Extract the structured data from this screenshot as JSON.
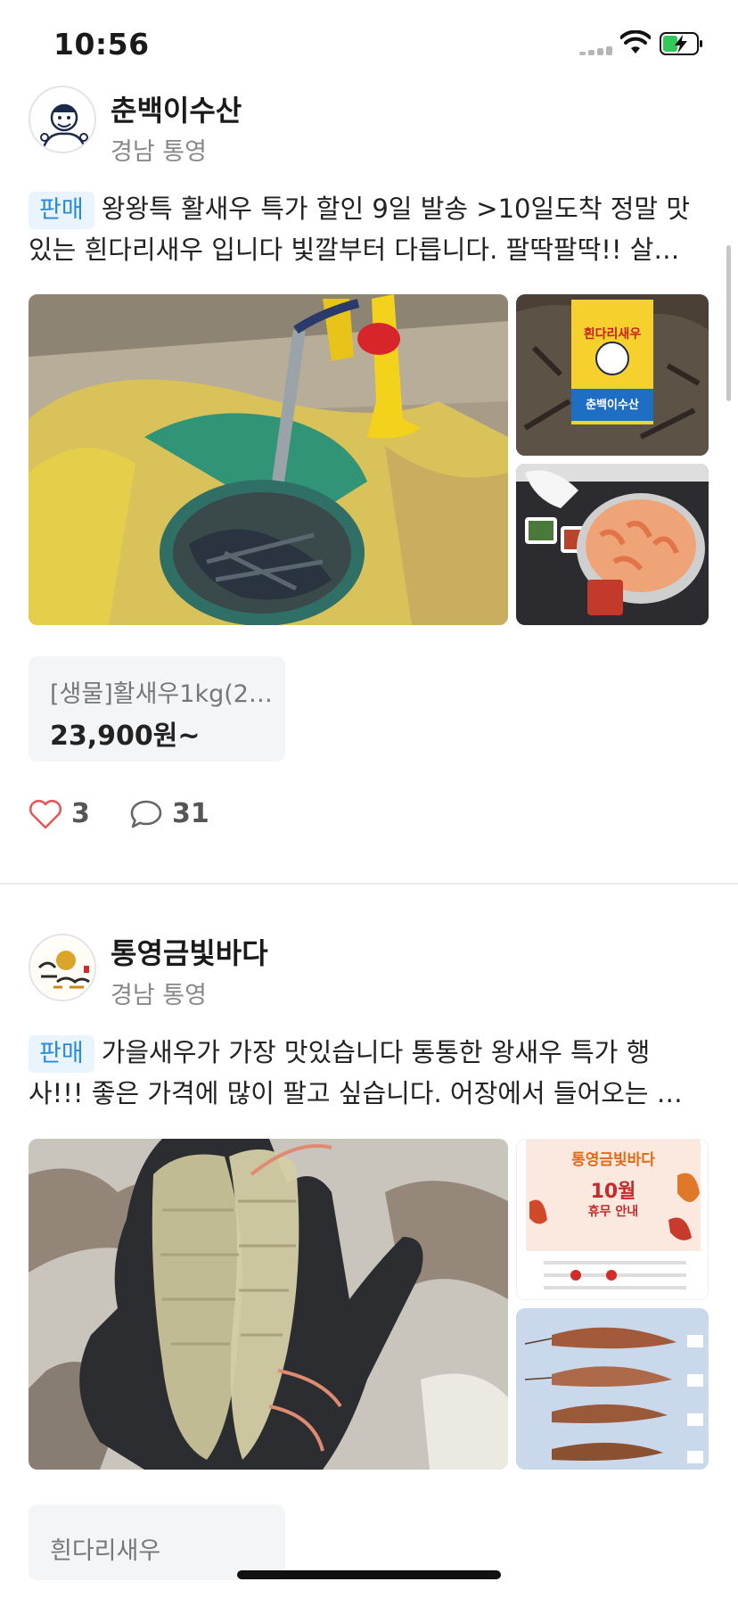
{
  "status_bar": {
    "time": "10:56"
  },
  "posts": [
    {
      "author": {
        "name": "춘백이수산",
        "location": "경남 통영"
      },
      "badge": "판매",
      "text_line1": "왕왕특 활새우 특가 할인 9일 발송 >10일도착 정말 맛",
      "text_line2": "있는 흰다리새우 입니다 빛깔부터 다릅니다. 팔딱팔딱!! 살…",
      "thumb_labels": {
        "box_title": "흰다리새우",
        "box_brand": "춘백이수산"
      },
      "product": {
        "name": "[생물]활새우1kg(2…",
        "price": "23,900원~"
      },
      "likes": "3",
      "comments": "31"
    },
    {
      "author": {
        "name": "통영금빛바다",
        "location": "경남 통영"
      },
      "badge": "판매",
      "text_line1": "가을새우가 가장 맛있습니다 통통한 왕새우 특가 행",
      "text_line2": "사!!! 좋은 가격에 많이 팔고 싶습니다. 어장에서 들어오는 …",
      "thumb_labels": {
        "flyer_title": "통영금빛바다",
        "flyer_month": "10월",
        "flyer_sub": "휴무 안내"
      },
      "product": {
        "name": "흰다리새우"
      }
    }
  ],
  "colors": {
    "accent_blue": "#2a8ad6",
    "badge_bg": "#e9f4fd",
    "heart": "#e05a5a"
  },
  "icons": [
    "signal-icon",
    "wifi-icon",
    "battery-charging-icon",
    "heart-icon",
    "comment-icon"
  ]
}
